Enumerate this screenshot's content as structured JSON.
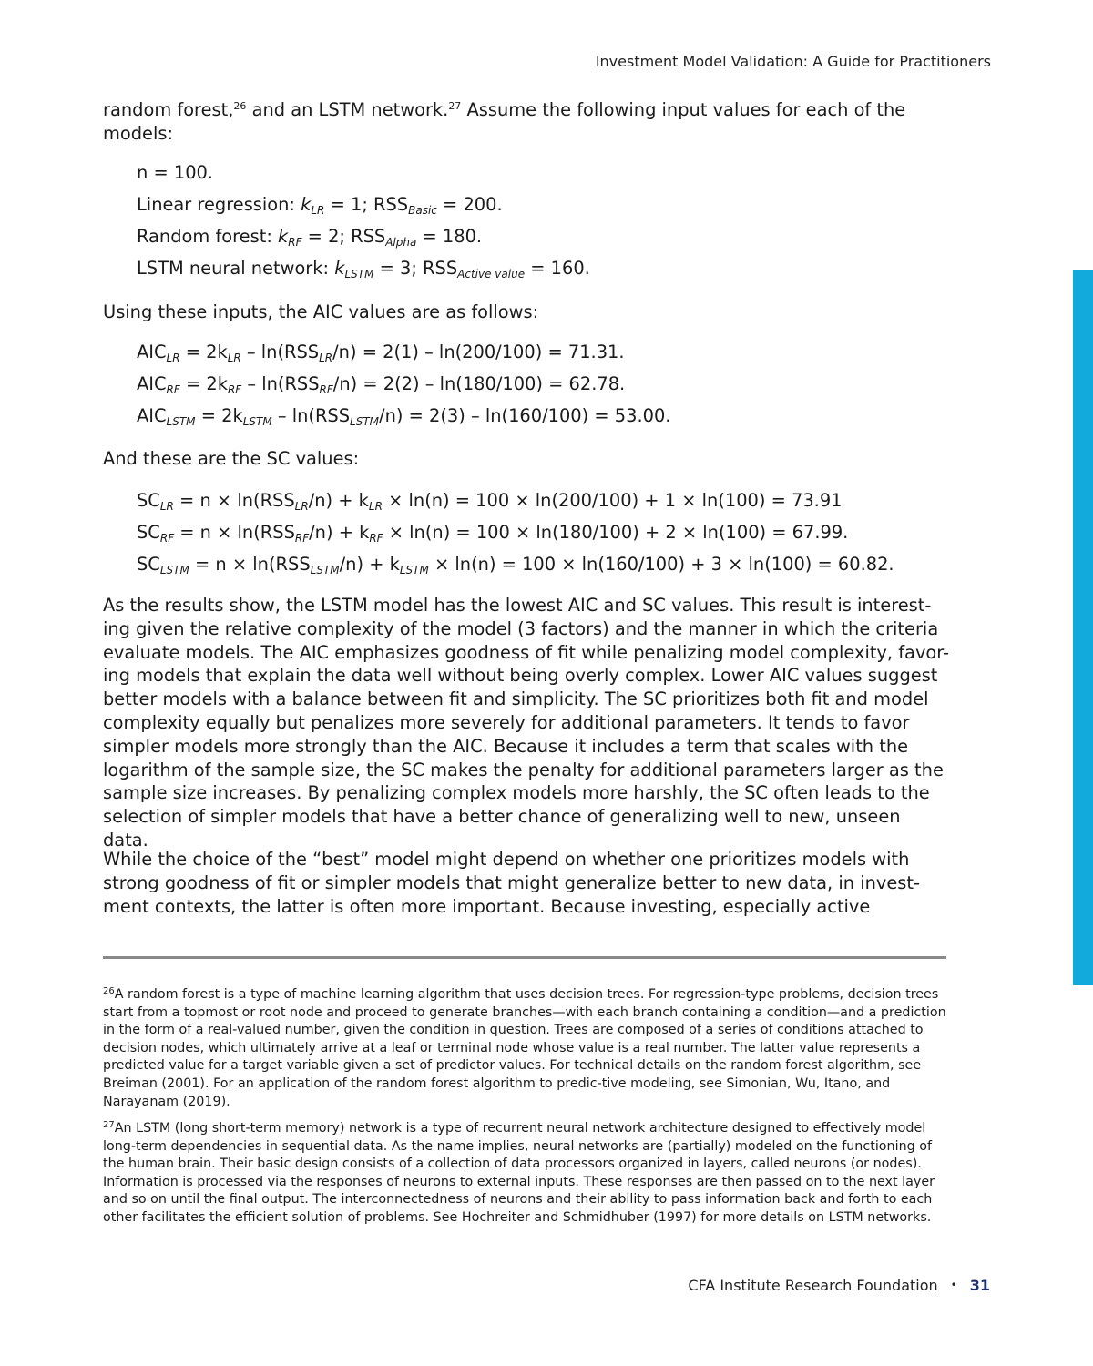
{
  "header": {
    "title": "Investment Model Validation: A Guide for Practitioners"
  },
  "intro": {
    "text_before_26": "random forest,",
    "ref_26": "26",
    "text_middle": " and an LSTM network.",
    "ref_27": "27",
    "text_after": " Assume the following input values for each of the models:"
  },
  "inputs": {
    "n_line": "n = 100.",
    "lr": {
      "label": "Linear regression: ",
      "k": "k",
      "k_sub": "LR",
      "k_val": " = 1; RSS",
      "rss_sub": "Basic",
      "rss_val": " = 200."
    },
    "rf": {
      "label": "Random forest: ",
      "k": "k",
      "k_sub": "RF",
      "k_val": " = 2; RSS",
      "rss_sub": "Alpha",
      "rss_val": " = 180."
    },
    "lstm": {
      "label": "LSTM neural network: ",
      "k": "k",
      "k_sub": "LSTM",
      "k_val": " = 3; RSS",
      "rss_sub": "Active value",
      "rss_val": " = 160."
    }
  },
  "aic_intro": "Using these inputs, the AIC values are as follows:",
  "aic": [
    {
      "sub": "LR",
      "rest": " = 2k",
      "ksub": "LR",
      "rest2": " – ln(RSS",
      "rsub": "LR",
      "rest3": "/n) = 2(1) – ln(200/100) = 71.31."
    },
    {
      "sub": "RF",
      "rest": " = 2k",
      "ksub": "RF",
      "rest2": " – ln(RSS",
      "rsub": "RF",
      "rest3": "/n) = 2(2) – ln(180/100) = 62.78."
    },
    {
      "sub": "LSTM",
      "rest": " = 2k",
      "ksub": "LSTM",
      "rest2": " – ln(RSS",
      "rsub": "LSTM",
      "rest3": "/n) = 2(3) – ln(160/100) = 53.00."
    }
  ],
  "sc_intro": "And these are the SC values:",
  "sc": [
    {
      "sub": "LR",
      "rest": " = n × ln(RSS",
      "rsub": "LR",
      "rest2": "/n) + k",
      "ksub": "LR",
      "rest3": " × ln(n) = 100 × ln(200/100) + 1 × ln(100) = 73.91"
    },
    {
      "sub": "RF",
      "rest": " = n × ln(RSS",
      "rsub": "RF",
      "rest2": "/n) + k",
      "ksub": "RF",
      "rest3": " × ln(n) = 100 × ln(180/100) + 2 × ln(100) = 67.99."
    },
    {
      "sub": "LSTM",
      "rest": " = n × ln(RSS",
      "rsub": "LSTM",
      "rest2": "/n) + k",
      "ksub": "LSTM",
      "rest3": " × ln(n) = 100 × ln(160/100) + 3 × ln(100) = 60.82."
    }
  ],
  "paragraph_results": "As the results show, the LSTM model has the lowest AIC and SC values. This result is interest-ing given the relative complexity of the model (3 factors) and the manner in which the criteria evaluate models. The AIC emphasizes goodness of fit while penalizing model complexity, favor-ing models that explain the data well without being overly complex. Lower AIC values suggest better models with a balance between fit and simplicity. The SC prioritizes both fit and model complexity equally but penalizes more severely for additional parameters. It tends to favor simpler models more strongly than the AIC. Because it includes a term that scales with the logarithm of the sample size, the SC makes the penalty for additional parameters larger as the sample size increases. By penalizing complex models more harshly, the SC often leads to the selection of simpler models that have a better chance of generalizing well to new, unseen data.",
  "paragraph_choice": "While the choice of the “best” model might depend on whether one prioritizes models with strong goodness of fit or simpler models that might generalize better to new data, in invest-ment contexts, the latter is often more important. Because investing, especially active",
  "footnotes": [
    {
      "num": "26",
      "text": "A random forest is a type of machine learning algorithm that uses decision trees. For regression-type problems, decision trees start from a topmost or root node and proceed to generate branches—with each branch containing a condition—and a prediction in the form of a real-valued number, given the condition in question. Trees are composed of a series of conditions attached to decision nodes, which ultimately arrive at a leaf or terminal node whose value is a real number. The latter value represents a predicted value for a target variable given a set of predictor values. For technical details on the random forest algorithm, see Breiman (2001). For an application of the random forest algorithm to predic-tive modeling, see Simonian, Wu, Itano, and Narayanam (2019)."
    },
    {
      "num": "27",
      "text": "An LSTM (long short-term memory) network is a type of recurrent neural network architecture designed to effectively model long-term dependencies in sequential data. As the name implies, neural networks are (partially) modeled on the functioning of the human brain. Their basic design consists of a collection of data processors organized in layers, called neurons (or nodes). Information is processed via the responses of neurons to external inputs. These responses are then passed on to the next layer and so on until the final output. The interconnectedness of neurons and their ability to pass information back and forth to each other facilitates the efficient solution of problems. See Hochreiter and Schmidhuber (1997) for more details on LSTM networks."
    }
  ],
  "footer": {
    "publisher": "CFA Institute Research Foundation",
    "bullet": "•",
    "page_number": "31"
  },
  "colors": {
    "side_tab": "#12a9dd",
    "page_number": "#1e2f6e",
    "rule": "#8a8a8a"
  }
}
